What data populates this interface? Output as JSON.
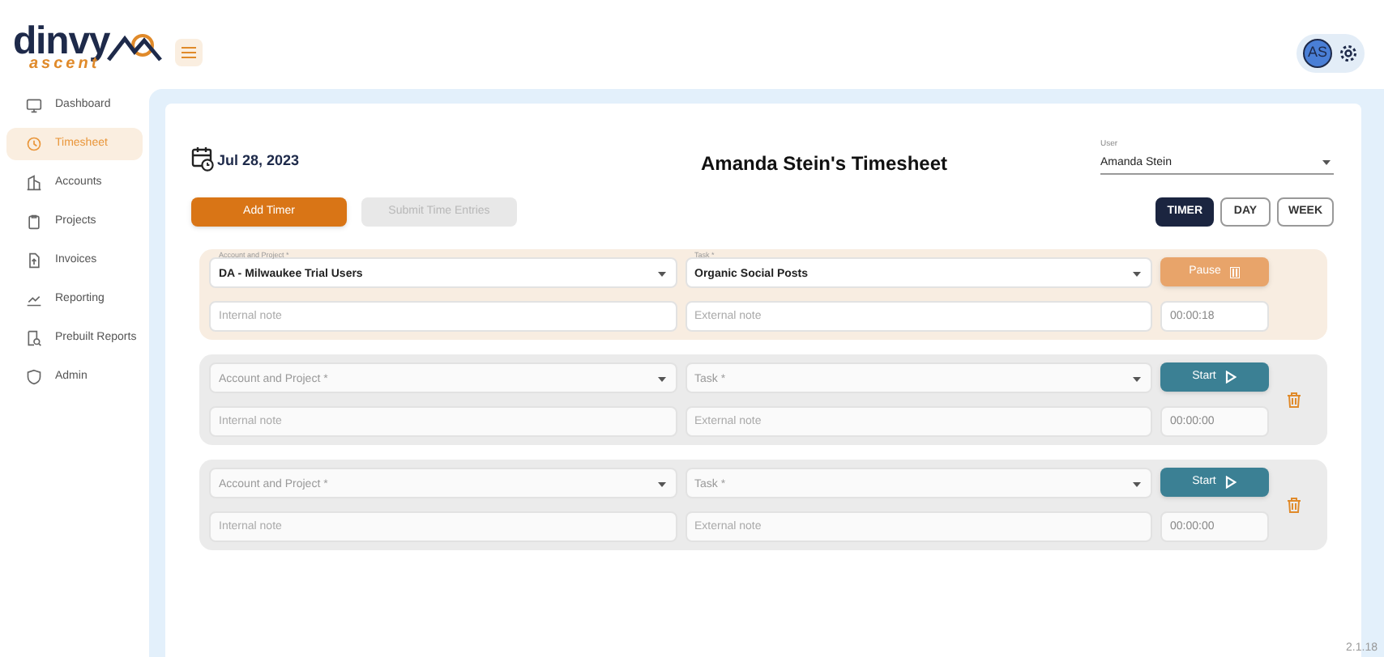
{
  "logo": {
    "name": "dinvy",
    "tagline": "ascent"
  },
  "header": {
    "avatar": "AS"
  },
  "sidebar": {
    "items": [
      {
        "label": "Dashboard",
        "selected": false
      },
      {
        "label": "Timesheet",
        "selected": true
      },
      {
        "label": "Accounts",
        "selected": false
      },
      {
        "label": "Projects",
        "selected": false
      },
      {
        "label": "Invoices",
        "selected": false
      },
      {
        "label": "Reporting",
        "selected": false
      },
      {
        "label": "Prebuilt Reports",
        "selected": false
      },
      {
        "label": "Admin",
        "selected": false
      }
    ]
  },
  "timesheet": {
    "date": "Jul 28, 2023",
    "title": "Amanda Stein's Timesheet",
    "user": {
      "label": "User",
      "value": "Amanda Stein"
    },
    "buttons": [
      {
        "label": "Add Timer",
        "disabled": false
      },
      {
        "label": "Submit Time Entries",
        "disabled": true
      }
    ],
    "views": [
      {
        "label": "TIMER",
        "selected": true
      },
      {
        "label": "DAY",
        "selected": false
      },
      {
        "label": "WEEK",
        "selected": false
      }
    ],
    "timers": [
      {
        "running": true,
        "account": {
          "label": "Account and Project *",
          "value": "DA - Milwaukee Trial Users"
        },
        "task": {
          "label": "Task *",
          "value": "Organic Social Posts"
        },
        "internal_note": {
          "placeholder": "Internal note"
        },
        "external_note": {
          "placeholder": "External note"
        },
        "action": "Pause",
        "time": "00:00:18",
        "deletable": false
      },
      {
        "running": false,
        "account": {
          "label": "Account and Project *"
        },
        "task": {
          "label": "Task *"
        },
        "internal_note": {
          "placeholder": "Internal note"
        },
        "external_note": {
          "placeholder": "External note"
        },
        "action": "Start",
        "time": "00:00:00",
        "deletable": true
      },
      {
        "running": false,
        "account": {
          "label": "Account and Project *"
        },
        "task": {
          "label": "Task *"
        },
        "internal_note": {
          "placeholder": "Internal note"
        },
        "external_note": {
          "placeholder": "External note"
        },
        "action": "Start",
        "time": "00:00:00",
        "deletable": true
      }
    ]
  },
  "version": "2.1.18"
}
